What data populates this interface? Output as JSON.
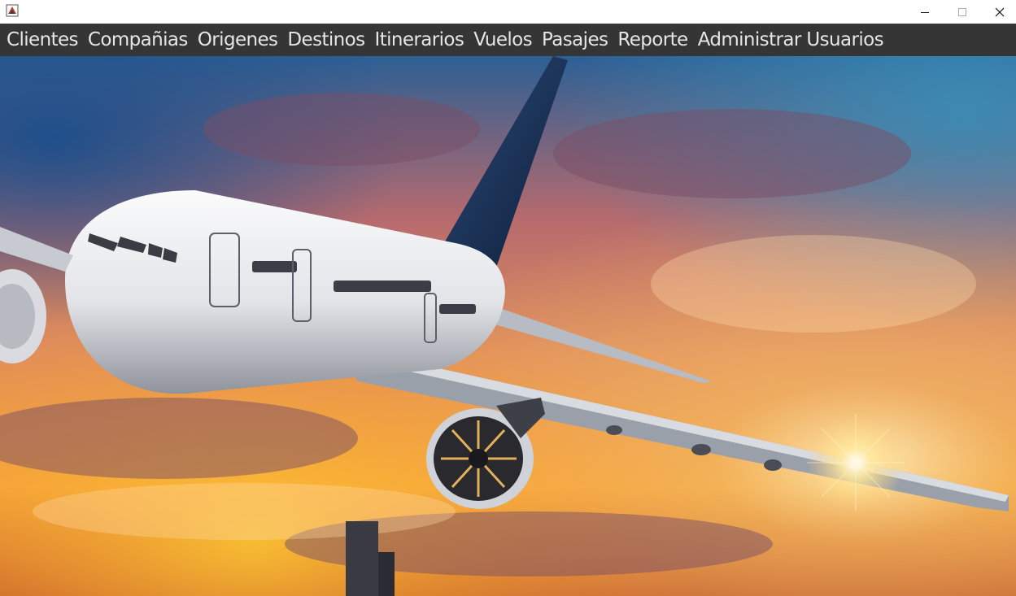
{
  "window": {
    "icon": "java-app-icon",
    "controls": {
      "minimize_icon": "minimize-icon",
      "maximize_icon": "maximize-icon",
      "close_icon": "close-icon"
    }
  },
  "menubar": {
    "background": "#353535",
    "text_color": "#e6e6e6",
    "items": [
      {
        "label": "Clientes"
      },
      {
        "label": "Compañias"
      },
      {
        "label": "Origenes"
      },
      {
        "label": "Destinos"
      },
      {
        "label": "Itinerarios"
      },
      {
        "label": "Vuelos"
      },
      {
        "label": "Pasajes"
      },
      {
        "label": "Reporte"
      },
      {
        "label": "Administrar Usuarios"
      }
    ]
  },
  "background": {
    "image": "airplane-sunset-photo",
    "colors": {
      "sky_blue": "#2f6fa8",
      "sunset_orange": "#f4a23a",
      "cloud_pink": "#d9775f"
    }
  }
}
